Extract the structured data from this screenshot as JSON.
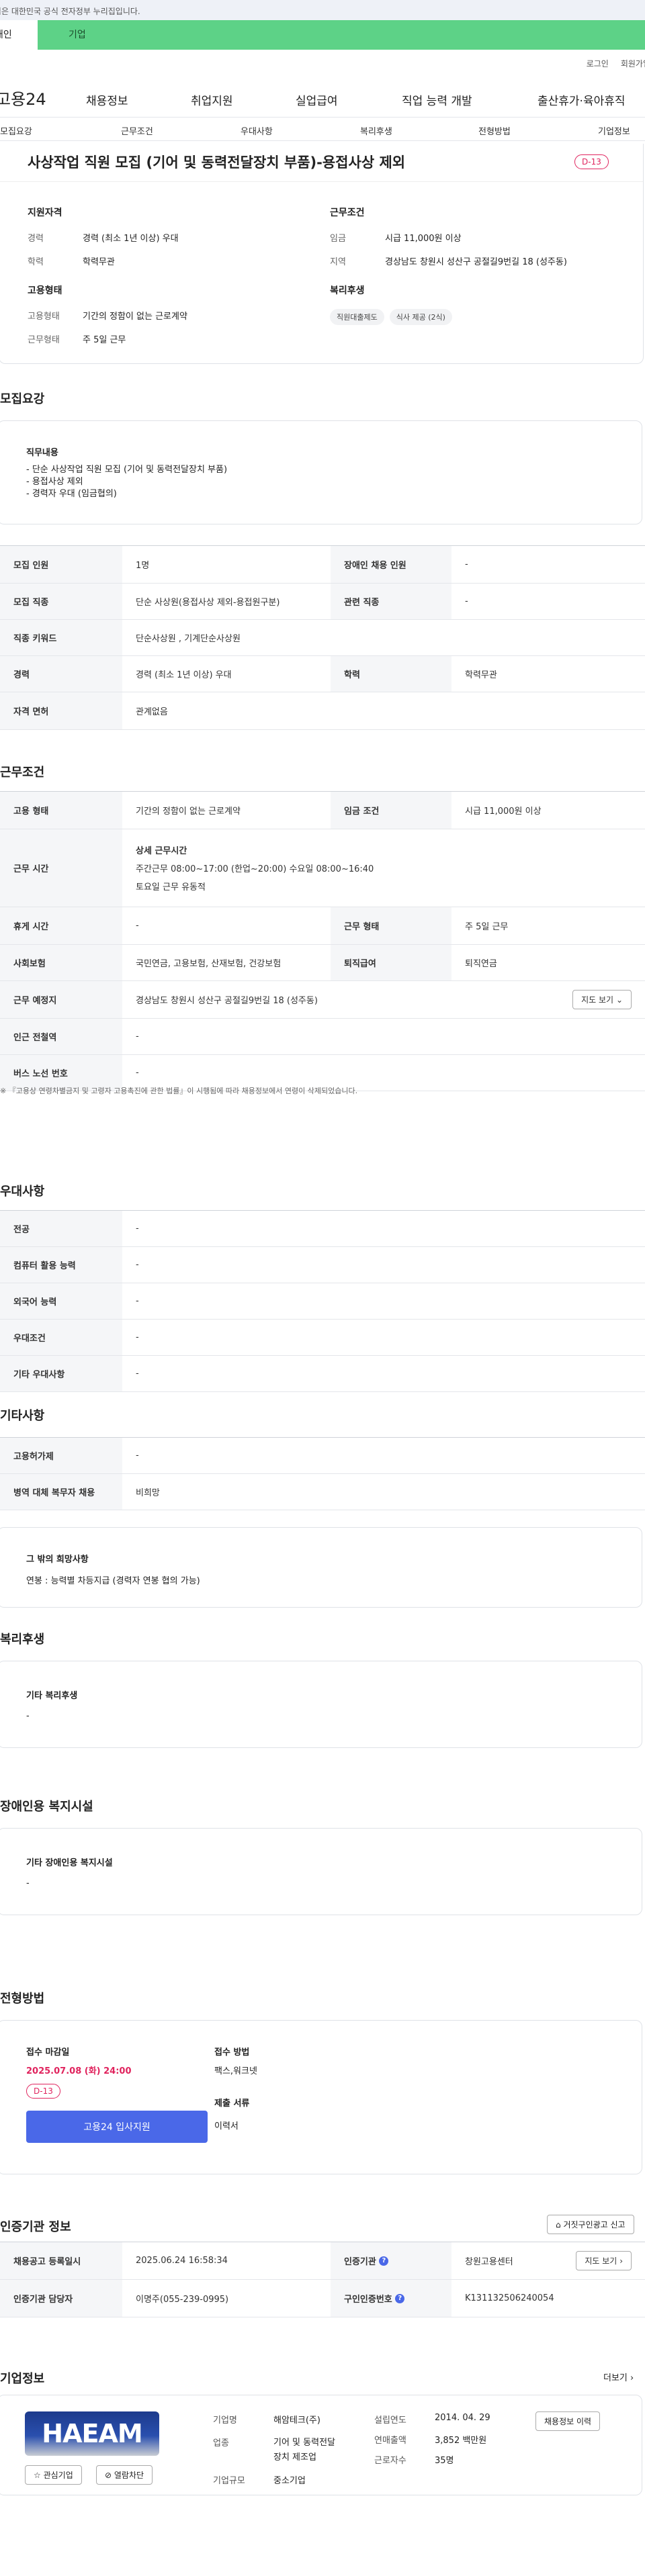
{
  "banner": {
    "text": "이 누리집은 대한민국 공식 전자정부 누리집입니다."
  },
  "tabs": [
    {
      "label": "개인"
    },
    {
      "label": "기업"
    }
  ],
  "util": {
    "login": "로그인",
    "signup": "회원가입"
  },
  "logo": "고용24",
  "gnb": [
    "채용정보",
    "취업지원",
    "실업급여",
    "직업 능력 개발",
    "출산휴가·육아휴직"
  ],
  "subnav": [
    "모집요강",
    "근무조건",
    "우대사항",
    "복리후생",
    "전형방법",
    "기업정보"
  ],
  "job": {
    "title": "사상작업 직원 모집 (기어 및 동력전달장치 부품)-용접사상 제외",
    "dday": "D-13"
  },
  "summary": {
    "qual": {
      "heading": "지원자격",
      "career_k": "경력",
      "career_v": "경력 (최소 1년 이상) 우대",
      "edu_k": "학력",
      "edu_v": "학력무관"
    },
    "cond": {
      "heading": "근무조건",
      "wage_k": "임금",
      "wage_v": "시급 11,000원 이상",
      "region_k": "지역",
      "region_v": "경상남도 창원시 성산구 공절길9번길 18 (성주동)"
    },
    "emp": {
      "heading": "고용형태",
      "type_k": "고용형태",
      "type_v": "기간의 정함이 없는 근로계약",
      "shift_k": "근무형태",
      "shift_v": "주 5일 근무"
    },
    "welfare": {
      "heading": "복리후생",
      "chips": [
        "직원대출제도",
        "식사 제공 (2식)"
      ]
    }
  },
  "recruit": {
    "title": "모집요강",
    "duty_h": "직무내용",
    "duty_lines": [
      "- 단순 사상작업 직원 모집 (기어 및 동력전달장치 부품)",
      "- 용접사상 제외",
      "- 경력자 우대 (임금협의)"
    ],
    "rows": [
      {
        "k1": "모집 인원",
        "v1": "1명",
        "k2": "장애인 채용 인원",
        "v2": "-"
      },
      {
        "k1": "모집 직종",
        "v1": "단순 사상원(용접사상 제외-용접원구분)",
        "k2": "관련 직종",
        "v2": "-"
      },
      {
        "k1": "직종 키워드",
        "v1": "단순사상원 , 기계단순사상원"
      },
      {
        "k1": "경력",
        "v1": "경력 (최소 1년 이상) 우대",
        "k2": "학력",
        "v2": "학력무관"
      },
      {
        "k1": "자격 면허",
        "v1": "관계없음"
      }
    ]
  },
  "work": {
    "title": "근무조건",
    "type_k": "고용 형태",
    "type_v": "기간의 정함이 없는 근로계약",
    "wage_k": "임금 조건",
    "wage_v": "시급 11,000원 이상",
    "hours_k": "근무 시간",
    "hours_h": "상세 근무시간",
    "hours_1": "주간근무  08:00~17:00 (한업~20:00)     수요일 08:00~16:40",
    "hours_2": "토요일 근무   유동적",
    "rest_k": "휴게 시간",
    "rest_v": "-",
    "shift_k": "근무 형태",
    "shift_v": "주 5일 근무",
    "ins_k": "사회보험",
    "ins_v": "국민연금, 고용보험, 산재보험, 건강보험",
    "sev_k": "퇴직급여",
    "sev_v": "퇴직연금",
    "place_k": "근무 예정지",
    "place_v": "경상남도 창원시 성산구 공절길9번길 18 (성주동)",
    "map_btn": "지도 보기",
    "sub_k": "인근 전철역",
    "sub_v": "-",
    "bus_k": "버스 노선 번호",
    "bus_v": "-",
    "note": "※ 『고용상 연령차별금지 및 고령자 고용촉진에 관한 법률』이 시행됨에 따라 채용정보에서 연령이 삭제되었습니다."
  },
  "pref": {
    "title": "우대사항",
    "rows": [
      {
        "k": "전공",
        "v": "-"
      },
      {
        "k": "컴퓨터 활용 능력",
        "v": "-"
      },
      {
        "k": "외국어 능력",
        "v": "-"
      },
      {
        "k": "우대조건",
        "v": "-"
      },
      {
        "k": "기타 우대사항",
        "v": "-"
      }
    ]
  },
  "etc": {
    "title": "기타사항",
    "rows": [
      {
        "k": "고용허가제",
        "v": "-"
      },
      {
        "k": "병역 대체 복무자 채용",
        "v": "비희망"
      }
    ],
    "other_h": "그 밖의 희망사항",
    "other_v": "연봉 : 능력별 차등지급 (경력자 연봉 협의 가능)"
  },
  "welfare": {
    "title": "복리후생",
    "box_h": "기타 복리후생",
    "box_v": "-"
  },
  "disabled": {
    "title": "장애인용 복지시설",
    "box_h": "기타 장애인용 복지시설",
    "box_v": "-"
  },
  "process": {
    "title": "전형방법",
    "deadline_h": "접수 마감일",
    "deadline_v": "2025.07.08 (화) 24:00",
    "dday": "D-13",
    "apply": "고용24 입사지원",
    "method_h": "접수 방법",
    "method_v": "팩스,워크넷",
    "docs_h": "제출 서류",
    "docs_v": "이력서"
  },
  "cert": {
    "title": "인증기관 정보",
    "report_btn": "거짓구인광고 신고",
    "reg_k": "채용공고 등록일시",
    "reg_v": "2025.06.24 16:58:34",
    "org_k": "인증기관",
    "org_v": "창원고용센터",
    "map_btn": "지도 보기",
    "mgr_k": "인증기관 담당자",
    "mgr_v": "이명주(055-239-0995)",
    "num_k": "구인인증번호",
    "num_v": "K131132506240054"
  },
  "company": {
    "title": "기업정보",
    "more": "더보기",
    "logo_text": "HAEAM",
    "fav_btn": "관심기업",
    "block_btn": "열람차단",
    "name_k": "기업명",
    "name_v": "해암테크(주)",
    "ind_k": "업종",
    "ind_v1": "기어 및 동력전달",
    "ind_v2": "장치 제조업",
    "size_k": "기업규모",
    "size_v": "중소기업",
    "est_k": "설립연도",
    "est_v": "2014. 04. 29",
    "sales_k": "연매출액",
    "sales_v": "3,852 백만원",
    "emp_k": "근로자수",
    "emp_v": "35명",
    "history_btn": "채용정보 이력"
  },
  "colors": {
    "tabbar": "#5dd287",
    "accent": "#4a68e8",
    "dday": "#e0245e"
  }
}
